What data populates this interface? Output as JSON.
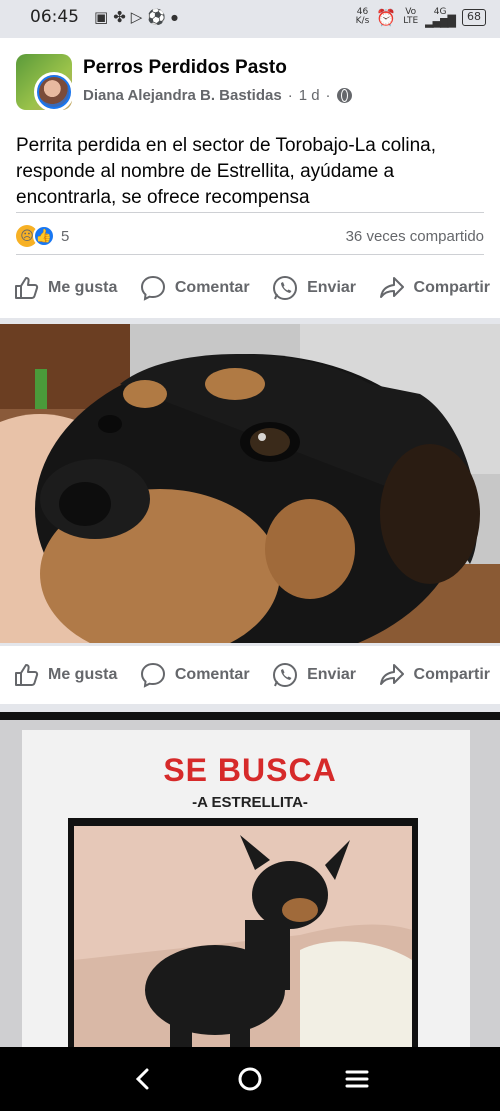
{
  "status_bar": {
    "time": "06:45",
    "net_speed_value": "46",
    "net_speed_unit": "K/s",
    "volte_top": "Vo",
    "volte_bottom": "LTE",
    "network": "4G",
    "battery": "68"
  },
  "post": {
    "group_name": "Perros Perdidos Pasto",
    "author": "Diana Alejandra B. Bastidas",
    "time": "1 d",
    "dot": "·",
    "text": "Perrita perdida en el sector de Torobajo-La colina, responde al nombre de Estrellita, ayúdame a encontrarla, se ofrece recompensa",
    "reaction_count": "5",
    "shares": "36 veces compartido",
    "reaction_icons": [
      "sad-face-icon",
      "like-thumb-icon"
    ]
  },
  "actions": {
    "like": "Me gusta",
    "comment": "Comentar",
    "send": "Enviar",
    "share": "Compartir"
  },
  "poster": {
    "title": "SE BUSCA",
    "subtitle": "-A ESTRELLITA-"
  },
  "colors": {
    "brand": "#1877f2",
    "poster_red": "#d62a2a",
    "secondary_text": "#65676b"
  }
}
